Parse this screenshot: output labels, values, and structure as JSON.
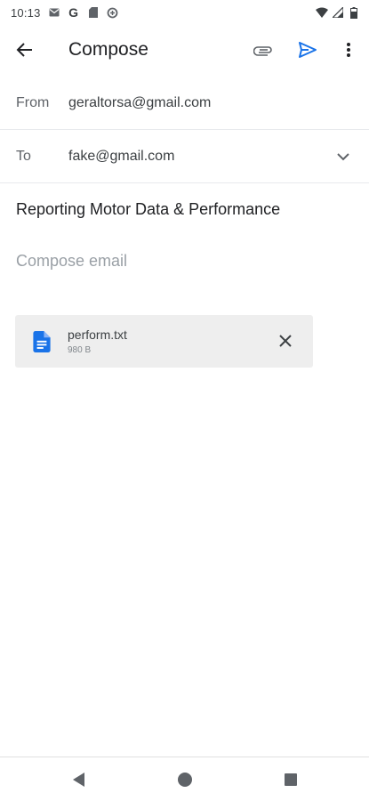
{
  "status_bar": {
    "time": "10:13",
    "icons": [
      "gmail-icon",
      "google-g-icon",
      "sd-card-icon",
      "data-saver-icon",
      "wifi-icon",
      "signal-icon",
      "battery-icon"
    ],
    "google_letter": "G"
  },
  "app_bar": {
    "title": "Compose",
    "icons": [
      "back-arrow-icon",
      "paperclip-icon",
      "send-icon",
      "more-vert-icon"
    ],
    "accent_color": "#1a73e8"
  },
  "from": {
    "label": "From",
    "value": "geraltorsa@gmail.com"
  },
  "to": {
    "label": "To",
    "value": "fake@gmail.com"
  },
  "subject": "Reporting Motor Data & Performance",
  "body_placeholder": "Compose email",
  "attachment": {
    "name": "perform.txt",
    "size": "980 B",
    "icon": "document-icon",
    "icon_color": "#1a73e8"
  },
  "nav_bar": {
    "icons": [
      "nav-back-icon",
      "nav-home-icon",
      "nav-recents-icon"
    ]
  }
}
